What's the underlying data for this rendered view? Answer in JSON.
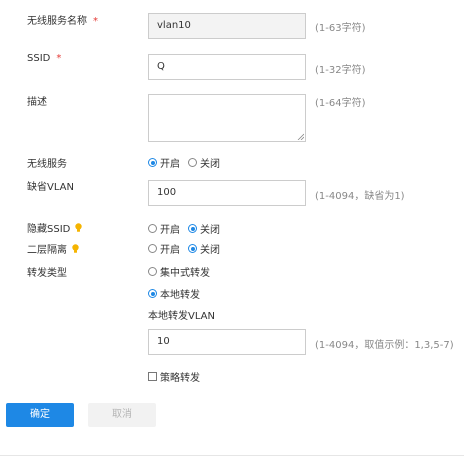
{
  "form": {
    "ssid_name": {
      "label": "无线服务名称",
      "required_mark": "*",
      "value": "vlan10",
      "hint": "(1-63字符)"
    },
    "ssid": {
      "label": "SSID",
      "required_mark": "*",
      "value": "Q",
      "hint": "(1-32字符)"
    },
    "description": {
      "label": "描述",
      "value": "",
      "hint": "(1-64字符)"
    },
    "wireless_service": {
      "label": "无线服务",
      "options": [
        "开启",
        "关闭"
      ],
      "selected": "开启"
    },
    "default_vlan": {
      "label": "缺省VLAN",
      "value": "100",
      "hint": "(1-4094，缺省为1)"
    },
    "hide_ssid": {
      "label": "隐藏SSID",
      "icon": "lightbulb-icon",
      "options": [
        "开启",
        "关闭"
      ],
      "selected": "关闭"
    },
    "l2_isolation": {
      "label": "二层隔离",
      "icon": "lightbulb-icon",
      "options": [
        "开启",
        "关闭"
      ],
      "selected": "关闭"
    },
    "forward_type": {
      "label": "转发类型",
      "options": [
        "集中式转发",
        "本地转发"
      ],
      "selected": "本地转发",
      "local_vlan": {
        "label": "本地转发VLAN",
        "value": "10",
        "hint": "(1-4094，取值示例：1,3,5-7)"
      },
      "policy_forward": {
        "label": "策略转发",
        "checked": false
      }
    }
  },
  "buttons": {
    "confirm": "确定",
    "cancel": "取消"
  },
  "colors": {
    "primary": "#1e88e5",
    "required": "#e53935",
    "bulb": "#f5b400"
  }
}
